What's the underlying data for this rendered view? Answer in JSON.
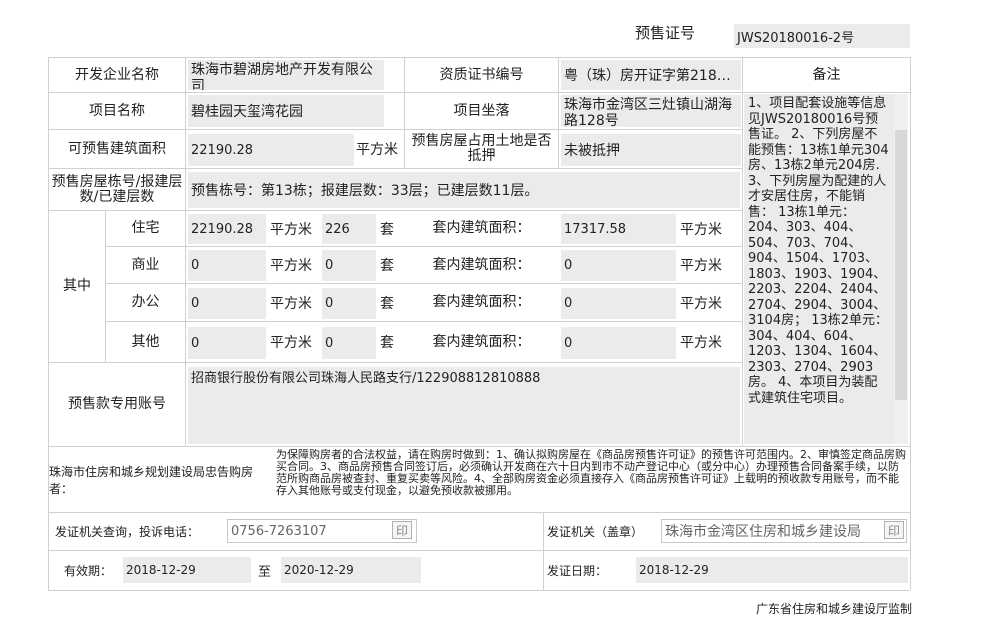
{
  "header": {
    "cert_label": "预售证号",
    "cert_no": "JWS20180016-2号"
  },
  "developer": {
    "label": "开发企业名称",
    "value": "珠海市碧湖房地产开发有限公司",
    "qual_label": "资质证书编号",
    "qual_value": "粤（珠）房开证字第218…"
  },
  "remarks": {
    "label": "备注",
    "text": "1、项目配套设施等信息见JWS20180016号预售证。 2、下列房屋不能预售：13栋1单元304房、13栋2单元204房. 3、下列房屋为配建的人才安居住房，不能销售： 13栋1单元：204、303、404、504、703、704、904、1504、1703、1803、1903、1904、2203、2204、2404、2704、2904、3004、3104房； 13栋2单元：304、404、604、1203、1304、1604、2303、2704、2903房。 4、本项目为装配式建筑住宅项目。"
  },
  "project": {
    "label": "项目名称",
    "value": "碧桂园天玺湾花园",
    "loc_label": "项目坐落",
    "loc_value": "珠海市金湾区三灶镇山湖海路128号"
  },
  "area": {
    "label": "可预售建筑面积",
    "value": "22190.28",
    "unit": "平方米",
    "mortgage_label": "预售房屋占用土地是否抵押",
    "mortgage_value": "未被抵押"
  },
  "floors": {
    "label": "预售房屋栋号/报建层数/已建层数",
    "value": "预售栋号：第13栋；报建层数：33层；已建层数11层。"
  },
  "breakdown": {
    "group_label": "其中",
    "inner_label": "套内建筑面积：",
    "unit_area": "平方米",
    "unit_count": "套",
    "rows": [
      {
        "type": "住宅",
        "area": "22190.28",
        "count": "226",
        "inner": "17317.58"
      },
      {
        "type": "商业",
        "area": "0",
        "count": "0",
        "inner": "0"
      },
      {
        "type": "办公",
        "area": "0",
        "count": "0",
        "inner": "0"
      },
      {
        "type": "其他",
        "area": "0",
        "count": "0",
        "inner": "0"
      }
    ]
  },
  "account": {
    "label": "预售款专用账号",
    "value": "招商银行股份有限公司珠海人民路支行/122908812810888"
  },
  "notice": {
    "label": "珠海市住房和城乡规划建设局忠告购房者：",
    "text": "为保障购房者的合法权益，请在购房时做到：1、确认拟购房屋在《商品房预售许可证》的预售许可范围内。2、审慎签定商品房购买合同。3、商品房预售合同签订后，必须确认开发商在六十日内到市不动产登记中心（或分中心）办理预售合同备案手续，以防范所购商品房被查封、重复买卖等风险。4、全部购房资金必须直接存入《商品房预售许可证》上载明的预收款专用账号，而不能存入其他账号或支付现金，以避免预收款被挪用。"
  },
  "contact": {
    "label": "发证机关查询，投诉电话：",
    "phone": "0756-7263107",
    "issuer_label": "发证机关（盖章）",
    "issuer": "珠海市金湾区住房和城乡建设局",
    "stamp_icon": "印"
  },
  "validity": {
    "label": "有效期：",
    "from": "2018-12-29",
    "to_label": "至",
    "to": "2020-12-29",
    "issue_label": "发证日期：",
    "issue_date": "2018-12-29"
  },
  "footer": {
    "text": "广东省住房和城乡建设厅监制"
  }
}
